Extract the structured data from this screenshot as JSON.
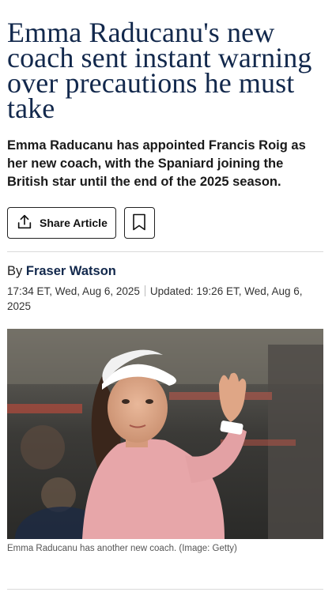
{
  "article": {
    "headline": "Emma Raducanu's new coach sent instant warning over precautions he must take",
    "standfirst": "Emma Raducanu has appointed Francis Roig as her new coach, with the Spaniard joining the British star until the end of the 2025 season.",
    "share_label": "Share Article",
    "byline_prefix": "By",
    "author": "Fraser Watson",
    "published": "17:34 ET, Wed, Aug 6, 2025",
    "updated": "Updated: 19:26 ET, Wed, Aug 6, 2025",
    "image_caption": "Emma Raducanu has another new coach.",
    "image_credit": "(Image: Getty)"
  },
  "icons": {
    "share": "share-upload-icon",
    "bookmark": "bookmark-icon"
  },
  "colors": {
    "headline": "#12284c",
    "author": "#12284c"
  }
}
